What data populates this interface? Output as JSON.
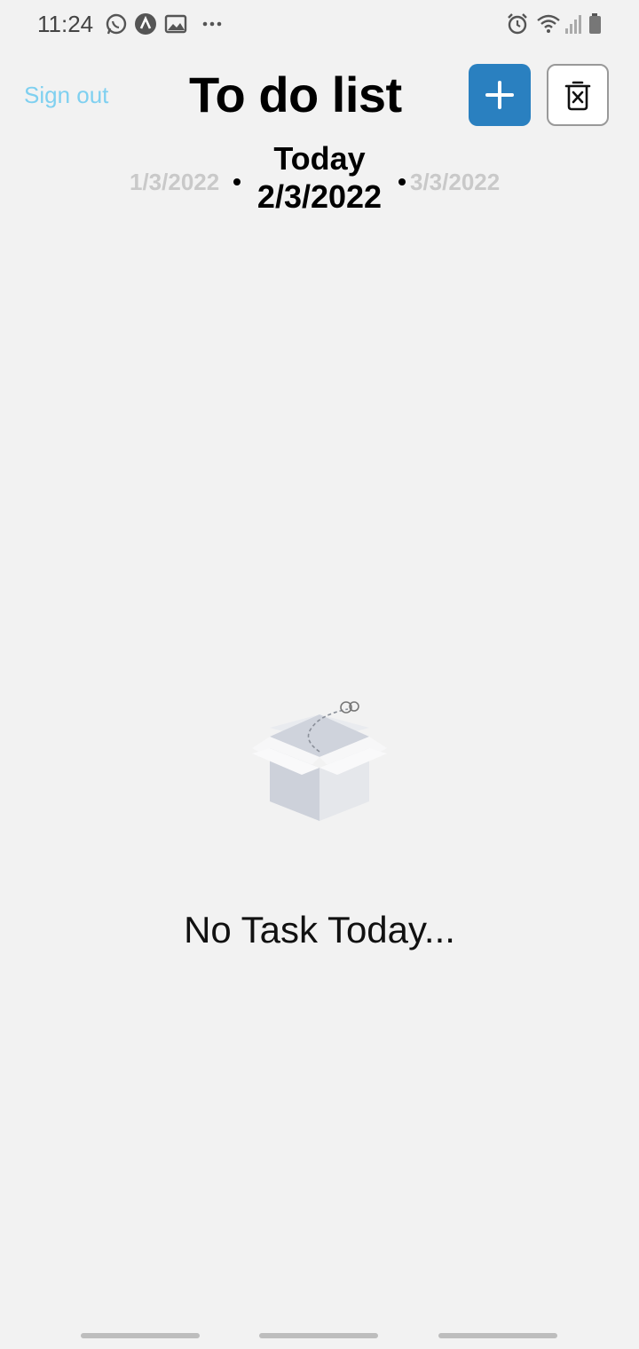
{
  "status_bar": {
    "time": "11:24",
    "icons": [
      "whatsapp-icon",
      "app-a-icon",
      "gallery-icon",
      "more-dots-icon",
      "alarm-icon",
      "wifi-icon",
      "signal-icon",
      "battery-icon"
    ]
  },
  "header": {
    "sign_out_label": "Sign out",
    "title": "To do list",
    "add_icon": "plus-icon",
    "delete_icon": "trash-x-icon",
    "accent_color": "#2a80c0",
    "sign_out_color": "#7fd0f0"
  },
  "date_nav": {
    "prev_date": "1/3/2022",
    "today_label": "Today",
    "current_date": "2/3/2022",
    "next_date": "3/3/2022"
  },
  "empty_state": {
    "icon": "empty-box-icon",
    "message": "No Task Today..."
  },
  "nav": {
    "buttons": [
      "recent-apps-icon",
      "home-icon",
      "back-icon"
    ]
  }
}
